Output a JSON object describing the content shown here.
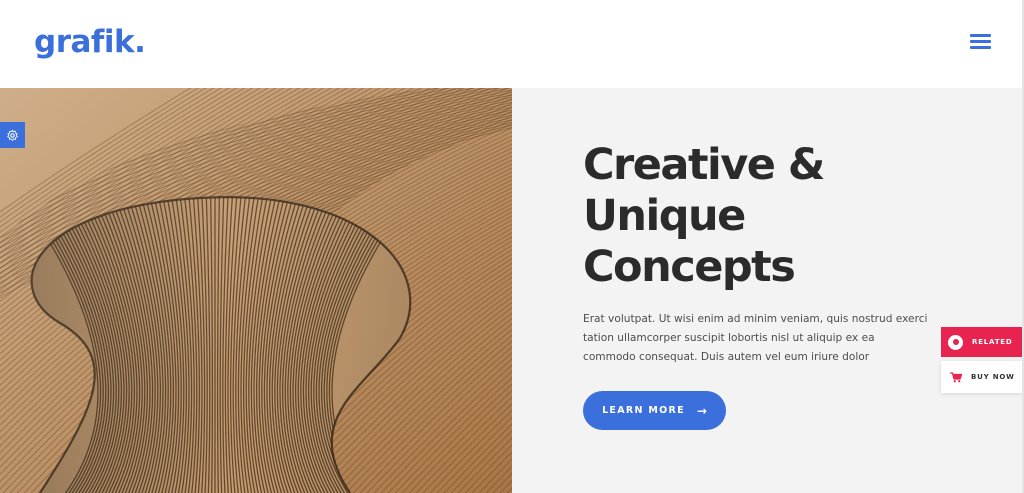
{
  "header": {
    "logo": "grafik.",
    "menu_icon": "hamburger-menu-icon"
  },
  "hero": {
    "image_alt": "wooden slatted architecture",
    "settings_icon": "gear-icon",
    "headline_lines": [
      "Creative &",
      "Unique",
      "Concepts"
    ],
    "body": "Erat volutpat. Ut wisi enim ad minim veniam, quis nostrud exerci tation ullamcorper suscipit lobortis nisl ut aliquip ex ea commodo consequat. Duis autem vel eum iriure dolor",
    "cta_label": "LEARN MORE",
    "cta_icon": "arrow-right-icon"
  },
  "side_tabs": {
    "related_label": "RELATED",
    "related_icon": "circle-icon",
    "buy_label": "BUY NOW",
    "buy_icon": "cart-icon"
  },
  "colors": {
    "accent": "#3a6fdc",
    "related": "#e8234f",
    "headline": "#2b2b2b",
    "panel_bg": "#f3f3f4"
  }
}
